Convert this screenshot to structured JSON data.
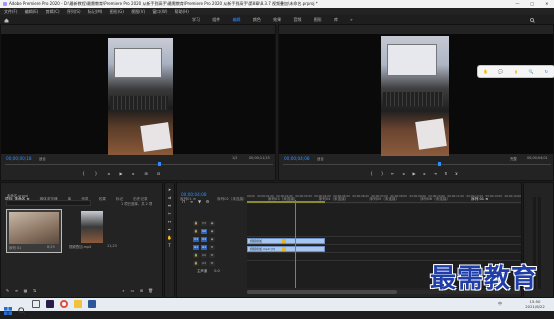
{
  "window": {
    "title": "Adobe Premiere Pro 2020 - D:\\最新教程\\最需教育\\Premiere Pro 2020 从新手到高手\\最需教育\\Premiere Pro 2020 从新手到高手\\第8章\\8.3.7 视频叠加\\未命名.prproj *",
    "controls": [
      "—",
      "□",
      "✕"
    ]
  },
  "menu": [
    "文件(F)",
    "编辑(E)",
    "剪辑(C)",
    "序列(S)",
    "标记(M)",
    "图形(G)",
    "视图(V)",
    "窗口(W)",
    "帮助(H)"
  ],
  "workspaces": [
    "学习",
    "组件",
    "编辑",
    "颜色",
    "效果",
    "音频",
    "图形",
    "库",
    "»"
  ],
  "source_panel": {
    "tabs": [
      "源: 8.3.7视频叠加.mp4",
      "效果控件",
      "音频剪辑混合器: 序列01",
      "元数据"
    ],
    "timecode_left": "00;00;00;18",
    "fit": "适合",
    "page": "1/2",
    "timecode_right": "00;00;11;23"
  },
  "program_panel": {
    "tabs": [
      "节目: 序列01 ≡"
    ],
    "timecode_left": "00;00;04;08",
    "fit": "适合",
    "quality": "完整",
    "timecode_right": "00;00;04;01"
  },
  "floating_toolbar": {
    "icons": [
      "hand-icon",
      "chat-icon",
      "folder-icon",
      "zoom-icon",
      "arrow-icon"
    ]
  },
  "project_panel": {
    "tabs": [
      "项目: 未命名 ≡",
      "媒体浏览器",
      "库",
      "信息",
      "效果",
      "标记",
      "历史记录"
    ],
    "project_file": "未命名.prproj",
    "item_count": "1 项已选择，共 2 项",
    "items": [
      {
        "name": "序列 01",
        "duration": "8;29"
      },
      {
        "name": "视频叠加.mp4",
        "duration": "11;23"
      }
    ]
  },
  "timeline": {
    "tabs": [
      "序列01 ≡",
      "序列02（未连接）",
      "序列03（未连接）",
      "序列04（未连接）",
      "序列05（未连接）",
      "序列06（未连接）",
      "序列 01 ≡"
    ],
    "timecode": "00;00;04;08",
    "ruler": [
      "00;00",
      "00;00;01;00",
      "00;00;02;00",
      "00;00;03;00",
      "00;00;04;00",
      "00;00;05;00",
      "00;00;06;00",
      "00;00;07;00",
      "00;00;08;00",
      "00;00;09;00",
      "00;00;10;00",
      "00;00;11;00",
      "00;00;12;00",
      "00;00;13;00",
      "00;00;14;00"
    ],
    "tracks": [
      {
        "label": "V3"
      },
      {
        "label": "V2"
      },
      {
        "label": "V1"
      },
      {
        "label": "A1"
      },
      {
        "label": "A2"
      },
      {
        "label": "A3"
      },
      {
        "label": "主声道",
        "value": "0.0"
      }
    ],
    "clips": [
      {
        "name": "视频叠加",
        "track": "V2"
      },
      {
        "name": "视频叠加.mp4 [V]",
        "track": "V1"
      }
    ]
  },
  "watermark": {
    "text": "最需教育"
  },
  "taskbar": {
    "time": "15:50",
    "date": "2021/6/22",
    "lang": "中"
  },
  "colors": {
    "accent": "#2f8cff",
    "clip": "#a7c7f0",
    "clip2": "#e0b82e",
    "watermark": "#1f3ea8"
  }
}
